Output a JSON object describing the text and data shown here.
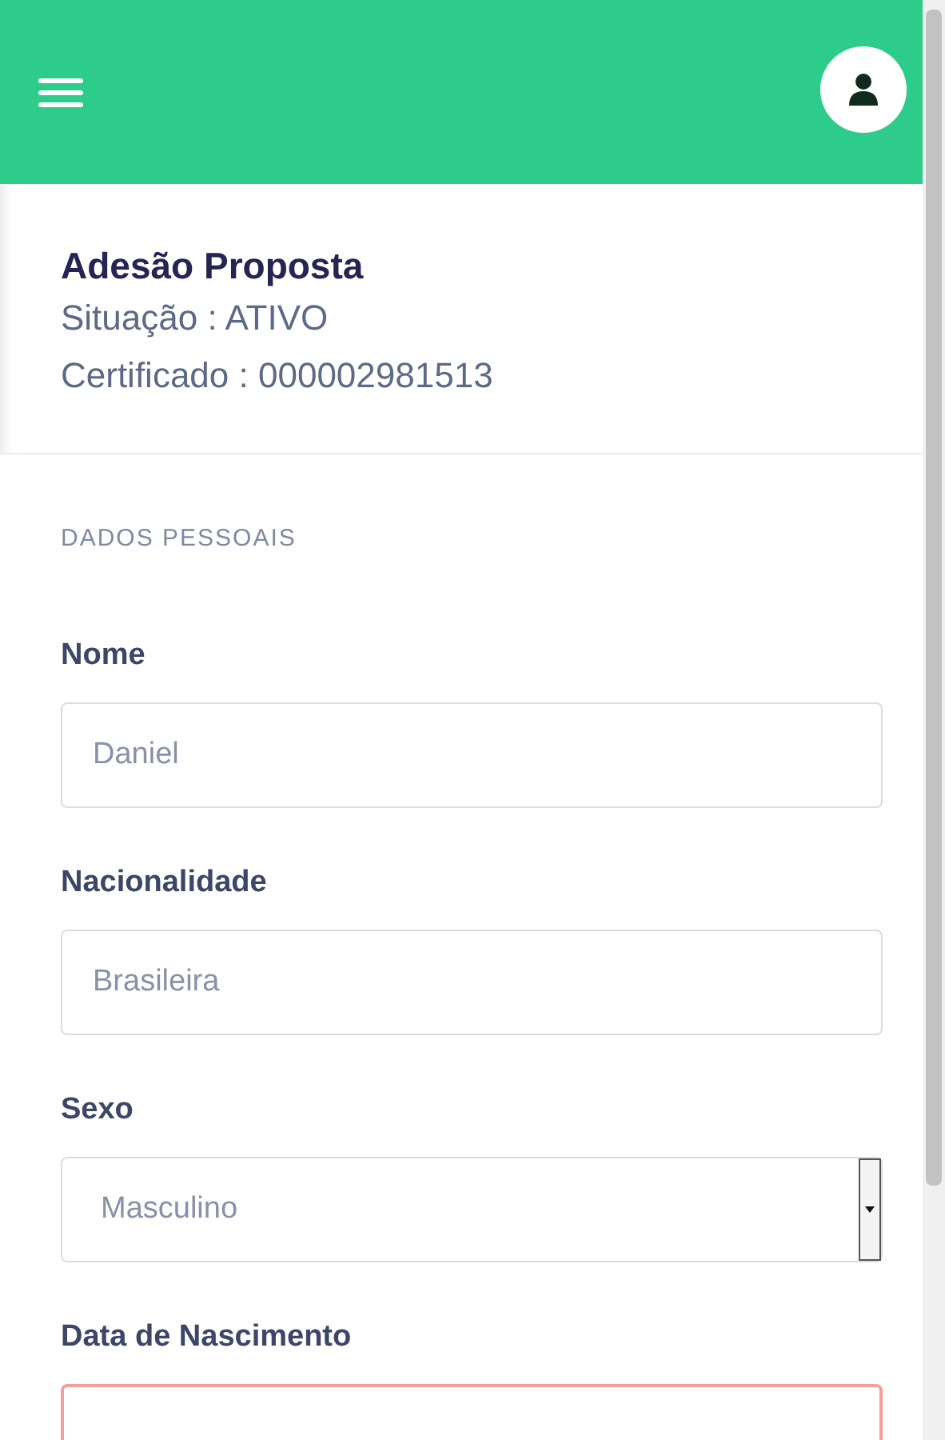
{
  "summary": {
    "title": "Adesão Proposta",
    "status": "Situação : ATIVO",
    "certificate": "Certificado : 000002981513"
  },
  "section": {
    "title": "DADOS PESSOAIS"
  },
  "fields": [
    {
      "kind": "text",
      "label": "Nome",
      "value": "Daniel",
      "invalid": false
    },
    {
      "kind": "text",
      "label": "Nacionalidade",
      "value": "Brasileira",
      "invalid": false
    },
    {
      "kind": "select",
      "label": "Sexo",
      "value": "Masculino",
      "invalid": false
    },
    {
      "kind": "text",
      "label": "Data de Nascimento",
      "invalid": true
    }
  ]
}
